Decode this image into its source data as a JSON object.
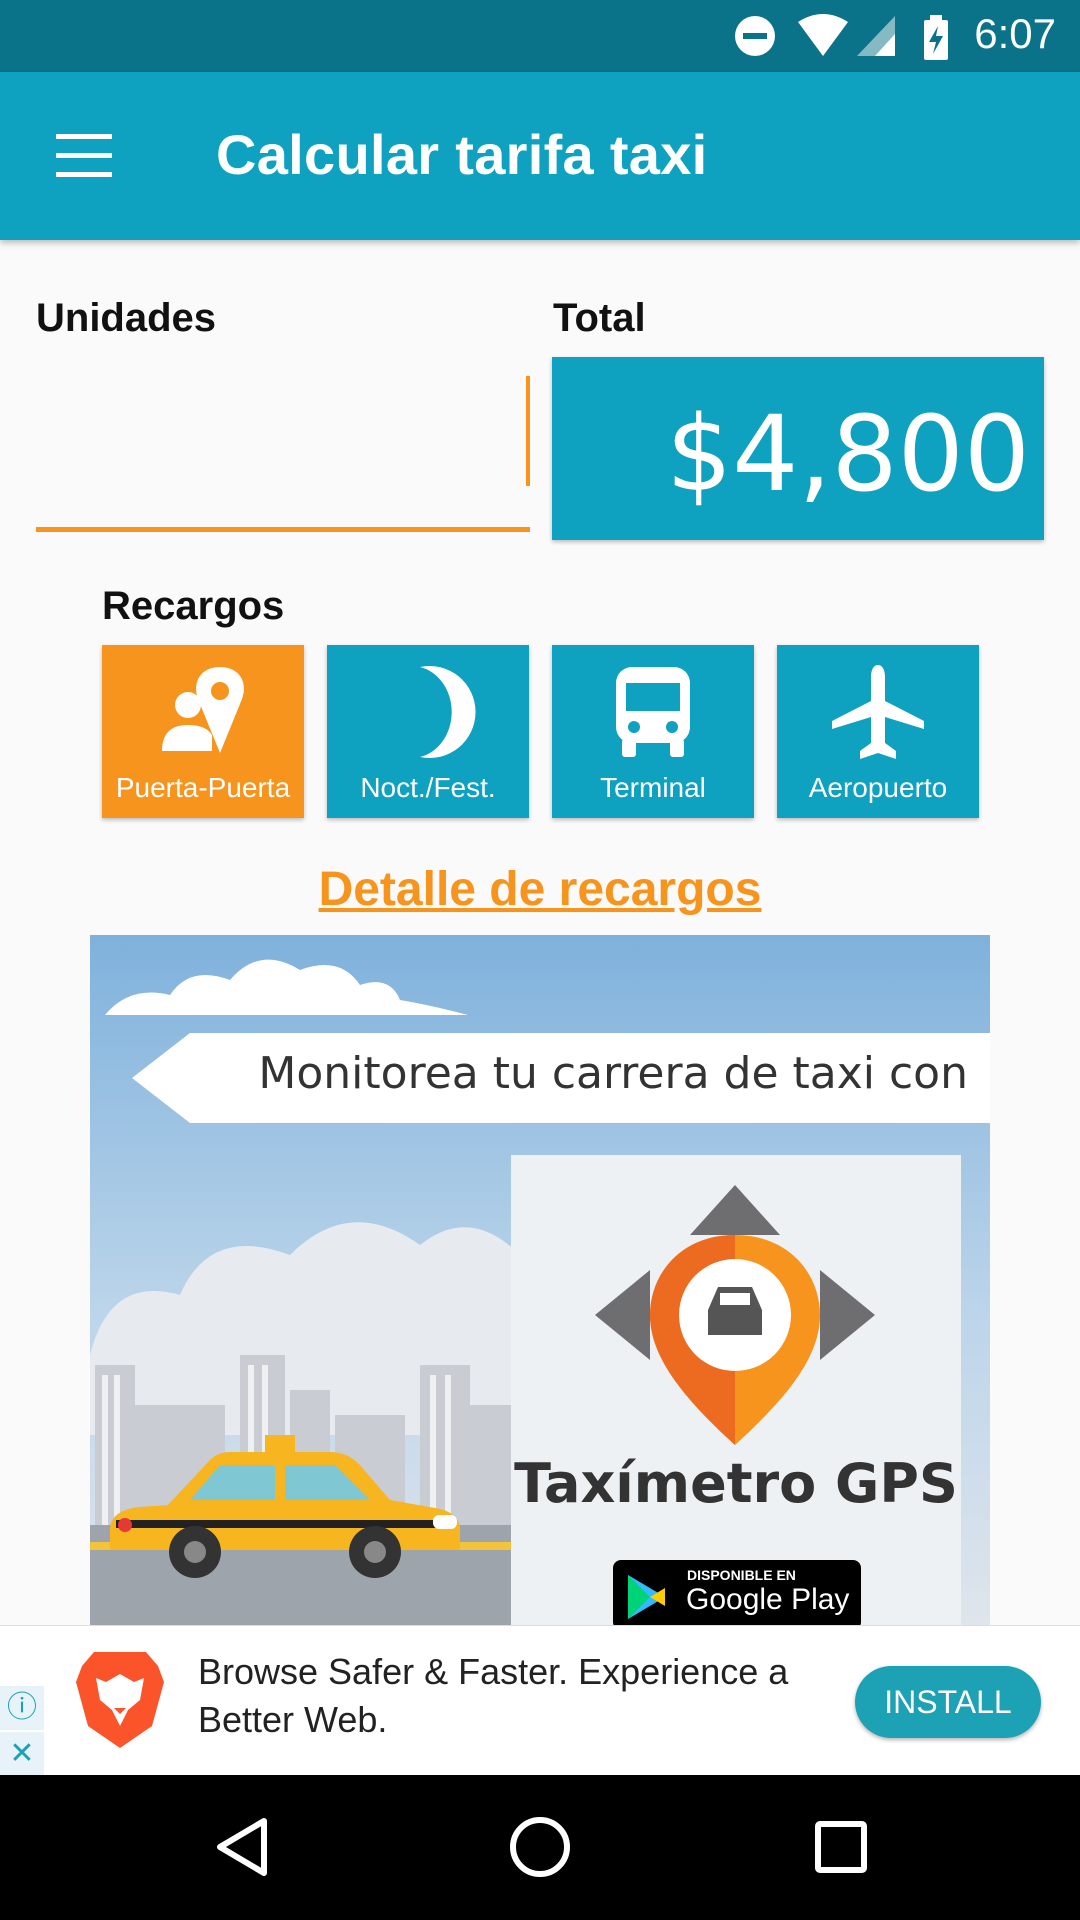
{
  "status_bar": {
    "time": "6:07"
  },
  "app_bar": {
    "title": "Calcular tarifa taxi"
  },
  "form": {
    "units_label": "Unidades",
    "units_value": "",
    "total_label": "Total",
    "total_value": "$4,800"
  },
  "surcharges": {
    "label": "Recargos",
    "items": [
      {
        "label": "Puerta-Puerta",
        "icon": "door-to-door-icon",
        "active": true
      },
      {
        "label": "Noct./Fest.",
        "icon": "moon-icon",
        "active": false
      },
      {
        "label": "Terminal",
        "icon": "bus-icon",
        "active": false
      },
      {
        "label": "Aeropuerto",
        "icon": "airplane-icon",
        "active": false
      }
    ],
    "detail_link": "Detalle de recargos"
  },
  "promo_banner": {
    "headline": "Monitorea tu carrera de taxi con",
    "brand": "Taxímetro GPS",
    "store_small": "DISPONIBLE EN",
    "store_big": "Google Play"
  },
  "ad": {
    "text": "Browse Safer & Faster. Experience a Better Web.",
    "button": "INSTALL"
  },
  "colors": {
    "primary": "#0ea2c0",
    "accent": "#f7941d",
    "status": "#0a7389"
  }
}
